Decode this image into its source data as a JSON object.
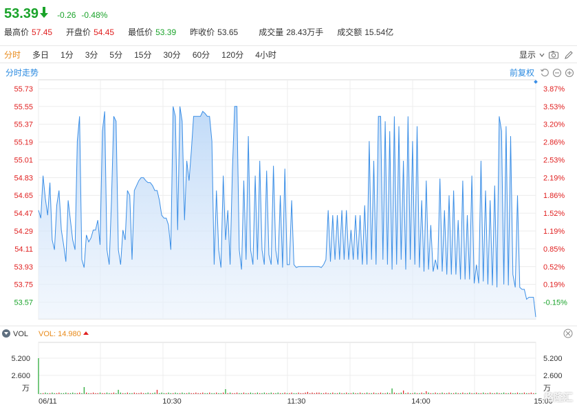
{
  "quote": {
    "price": "53.39",
    "change": "-0.26",
    "change_pct": "-0.48%",
    "stats": [
      {
        "label": "最高价",
        "value": "57.45",
        "color": "red"
      },
      {
        "label": "开盘价",
        "value": "54.45",
        "color": "red"
      },
      {
        "label": "最低价",
        "value": "53.39",
        "color": "green"
      },
      {
        "label": "昨收价",
        "value": "53.65",
        "color": "plain"
      },
      {
        "label": "成交量",
        "value": "28.43万手",
        "color": "plain"
      },
      {
        "label": "成交额",
        "value": "15.54亿",
        "color": "plain"
      }
    ]
  },
  "tabs": [
    "分时",
    "多日",
    "1分",
    "3分",
    "5分",
    "15分",
    "30分",
    "60分",
    "120分",
    "4小时"
  ],
  "active_tab": "分时",
  "toolbar": {
    "display_label": "显示"
  },
  "subbar": {
    "title": "分时走势",
    "adjust_label": "前复权"
  },
  "volume": {
    "title": "VOL",
    "value_label": "VOL: 14.980",
    "unit": "万",
    "ticks": [
      "5.200",
      "2.600"
    ]
  },
  "watermark": "格隆汇",
  "colors": {
    "up": "#e02020",
    "down": "#1aa32a",
    "line": "#3a8ee6",
    "fill": "#dbe9fa",
    "accent": "#e88a1a"
  },
  "chart_data": {
    "type": "area",
    "prev_close": 53.65,
    "y_ticks": [
      "55.73",
      "55.55",
      "55.37",
      "55.19",
      "55.01",
      "54.83",
      "54.65",
      "54.47",
      "54.29",
      "54.11",
      "53.93",
      "53.75",
      "53.57"
    ],
    "y_ticks_pct": [
      "3.87%",
      "3.53%",
      "3.20%",
      "2.86%",
      "2.53%",
      "2.19%",
      "1.86%",
      "1.52%",
      "1.19%",
      "0.85%",
      "0.52%",
      "0.19%",
      "-0.15%"
    ],
    "ylim": [
      53.4,
      55.82
    ],
    "x_labels": [
      "06/11",
      "10:30",
      "11:30",
      "14:00",
      "15:00"
    ],
    "prices": [
      54.5,
      54.42,
      54.85,
      54.62,
      54.45,
      54.78,
      54.2,
      54.1,
      54.55,
      54.7,
      54.3,
      54.15,
      53.98,
      54.6,
      54.4,
      54.2,
      54.1,
      55.2,
      55.45,
      54.0,
      53.92,
      54.25,
      54.18,
      54.22,
      54.3,
      54.3,
      54.4,
      54.15,
      55.3,
      55.5,
      54.1,
      53.95,
      54.6,
      55.45,
      55.4,
      54.1,
      53.95,
      54.3,
      54.2,
      54.7,
      54.65,
      54.0,
      54.7,
      54.75,
      54.8,
      54.83,
      54.83,
      54.8,
      54.78,
      54.78,
      54.75,
      54.7,
      54.7,
      54.6,
      54.45,
      54.42,
      54.42,
      54.35,
      54.1,
      55.55,
      55.45,
      54.3,
      55.55,
      55.4,
      54.4,
      55.0,
      54.8,
      55.1,
      55.45,
      55.45,
      55.45,
      55.45,
      55.5,
      55.48,
      55.45,
      55.45,
      55.2,
      53.95,
      54.7,
      54.1,
      53.92,
      54.85,
      54.2,
      54.5,
      53.95,
      54.9,
      55.55,
      55.55,
      54.1,
      53.9,
      54.8,
      54.0,
      55.25,
      54.1,
      53.95,
      54.85,
      54.0,
      55.0,
      54.1,
      53.95,
      54.9,
      54.05,
      53.95,
      54.95,
      54.1,
      53.95,
      54.65,
      53.92,
      54.92,
      53.95,
      53.95,
      54.6,
      53.95,
      53.92,
      53.93,
      53.93,
      53.93,
      53.93,
      53.93,
      53.93,
      53.93,
      53.93,
      53.93,
      53.93,
      53.92,
      53.95,
      54.0,
      54.5,
      53.98,
      54.45,
      54.0,
      54.45,
      54.0,
      54.5,
      54.0,
      54.5,
      54.0,
      54.3,
      54.0,
      54.45,
      54.0,
      54.45,
      53.95,
      54.55,
      53.95,
      55.2,
      54.0,
      55.0,
      53.95,
      55.45,
      55.45,
      54.0,
      55.4,
      53.95,
      55.3,
      53.9,
      55.45,
      53.95,
      55.35,
      54.0,
      55.0,
      53.9,
      55.45,
      54.0,
      55.2,
      53.95,
      55.35,
      53.92,
      54.6,
      53.88,
      54.8,
      53.9,
      54.35,
      53.88,
      54.0,
      53.9,
      54.82,
      53.88,
      54.5,
      53.85,
      54.65,
      53.85,
      54.7,
      53.85,
      54.4,
      53.8,
      54.8,
      53.8,
      54.45,
      53.8,
      54.85,
      53.76,
      53.95,
      53.76,
      55.0,
      53.78,
      54.7,
      53.75,
      54.6,
      53.74,
      54.75,
      53.72,
      55.45,
      55.3,
      53.75,
      55.35,
      53.74,
      55.25,
      53.85,
      53.72,
      54.65,
      53.72,
      53.7,
      53.7,
      53.6,
      53.62,
      53.62,
      53.62,
      53.42
    ]
  }
}
